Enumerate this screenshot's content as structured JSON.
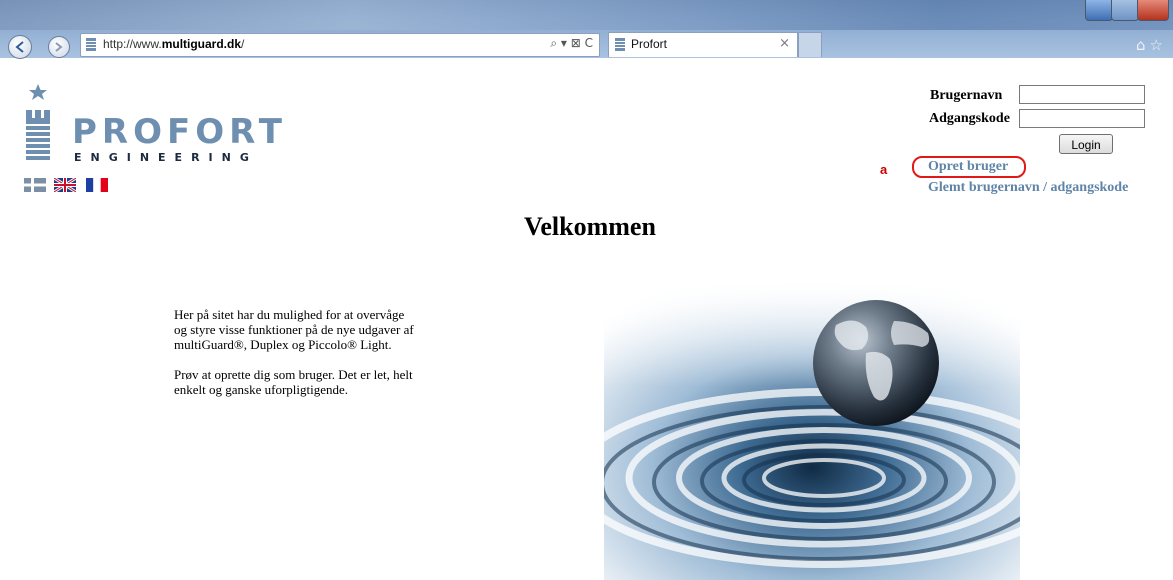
{
  "browser": {
    "address": {
      "prefix": "http://www.",
      "domain": "multiguard.dk",
      "suffix": "/"
    },
    "address_tools": "⌕ ▾ ⊠ C",
    "tab": {
      "title": "Profort",
      "close": "×"
    }
  },
  "page": {
    "logo": {
      "word": "PROFORT",
      "sub": "ENGINEERING"
    },
    "languages": [
      "Danish",
      "English",
      "French"
    ],
    "login": {
      "username_label": "Brugernavn",
      "password_label": "Adgangskode",
      "username_value": "",
      "password_value": "",
      "button": "Login"
    },
    "annotation_marker": "a",
    "create_user_link": "Opret bruger",
    "forgot_link": "Glemt brugernavn / adgangskode",
    "heading": "Velkommen",
    "intro": [
      "Her på sitet har du mulighed for at overvåge og styre visse funktioner på de nye udgaver af multiGuard®, Duplex og Piccolo® Light.",
      "Prøv at oprette dig som bruger. Det er let, helt enkelt og ganske uforpligtigende."
    ]
  },
  "colors": {
    "link": "#5f84a8",
    "logo": "#6f8fb0",
    "annotation": "#e01818"
  }
}
